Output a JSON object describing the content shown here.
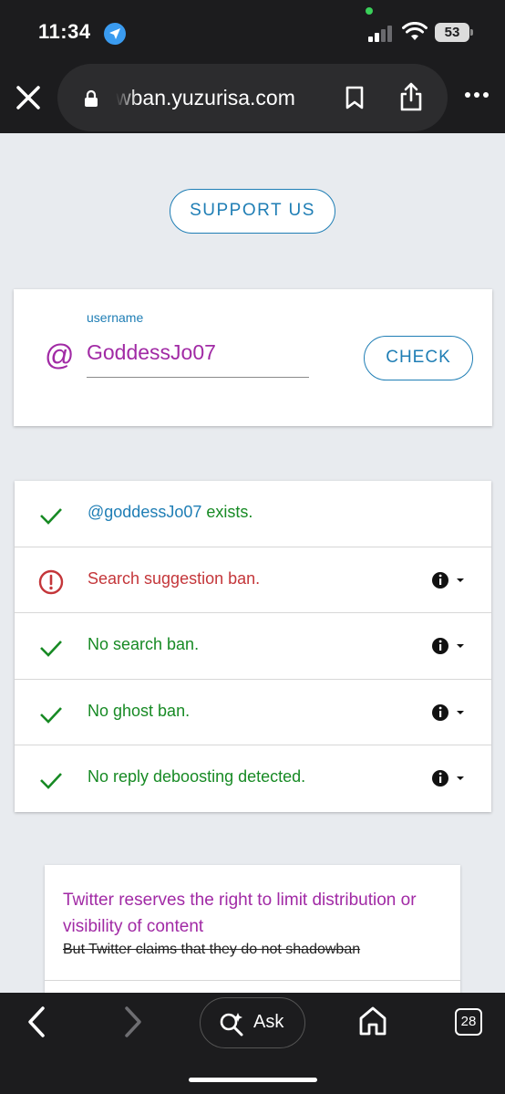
{
  "status_bar": {
    "time": "11:34",
    "battery": "53"
  },
  "browser": {
    "url": "wban.yuzurisa.com",
    "tab_count": "28",
    "ask_label": "Ask"
  },
  "page": {
    "support_label": "SUPPORT US",
    "username_label": "username",
    "at_symbol": "@",
    "username_value": "GoddessJo07",
    "check_label": "CHECK",
    "results": [
      {
        "status": "ok",
        "handle": "@goddessJo07",
        "text": " exists.",
        "has_info": false
      },
      {
        "status": "bad",
        "handle": "",
        "text": "Search suggestion ban.",
        "has_info": true
      },
      {
        "status": "ok",
        "handle": "",
        "text": "No search ban.",
        "has_info": true
      },
      {
        "status": "ok",
        "handle": "",
        "text": "No ghost ban.",
        "has_info": true
      },
      {
        "status": "ok",
        "handle": "",
        "text": "No reply deboosting detected.",
        "has_info": true
      }
    ],
    "notice_title": "Twitter reserves the right to limit distribution or visibility of content",
    "notice_strike": "But Twitter claims that they do not shadowban"
  },
  "colors": {
    "accent_blue": "#1f7eb5",
    "brand_purple": "#a12aa5",
    "ok_green": "#178a24",
    "error_red": "#c4363a"
  }
}
